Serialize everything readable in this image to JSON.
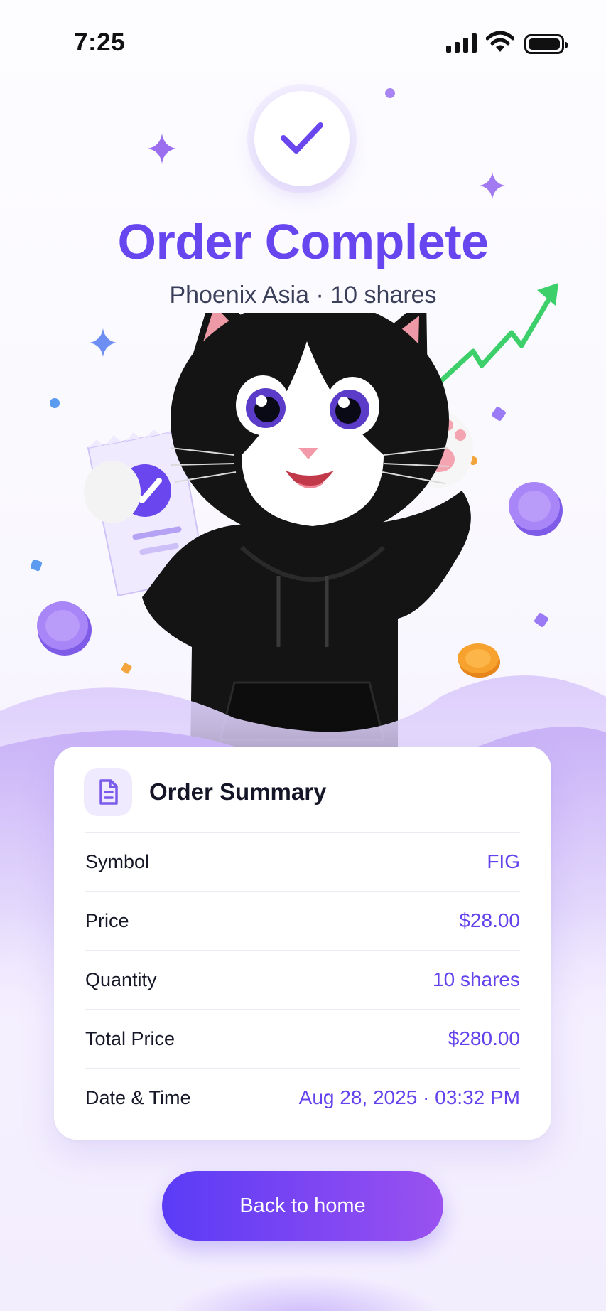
{
  "status_bar": {
    "time": "7:25"
  },
  "header": {
    "title": "Order Complete",
    "subtitle": "Phoenix Asia · 10 shares"
  },
  "summary": {
    "title": "Order Summary",
    "rows": [
      {
        "label": "Symbol",
        "value": "FIG"
      },
      {
        "label": "Price",
        "value": "$28.00"
      },
      {
        "label": "Quantity",
        "value": "10 shares"
      },
      {
        "label": "Total Price",
        "value": "$280.00"
      },
      {
        "label": "Date & Time",
        "value": "Aug 28, 2025 · 03:32 PM"
      }
    ]
  },
  "actions": {
    "back_home": "Back to home"
  },
  "colors": {
    "accent": "#6746f0",
    "trend": "#3ccf6a",
    "coin_purple": "#9b7bf5",
    "coin_orange": "#f7a22e"
  },
  "icons": {
    "check": "check-icon",
    "document": "document-icon",
    "signal": "signal-icon",
    "wifi": "wifi-icon",
    "battery": "battery-icon"
  }
}
